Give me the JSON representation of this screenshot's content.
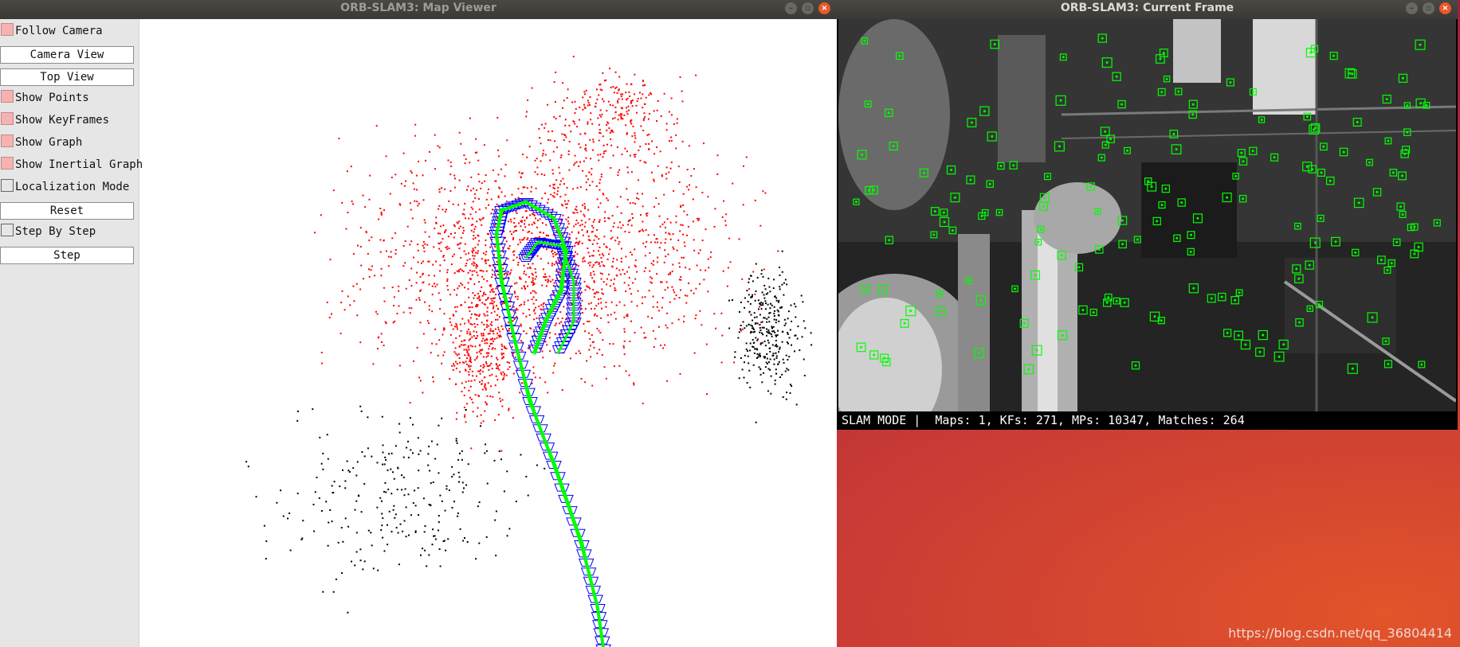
{
  "map_viewer": {
    "title": "ORB-SLAM3: Map Viewer",
    "controls": [
      {
        "type": "checkbox",
        "label": "Follow Camera",
        "checked": true
      },
      {
        "type": "button",
        "label": "Camera View"
      },
      {
        "type": "button",
        "label": "Top View"
      },
      {
        "type": "checkbox",
        "label": "Show Points",
        "checked": true
      },
      {
        "type": "checkbox",
        "label": "Show KeyFrames",
        "checked": true
      },
      {
        "type": "checkbox",
        "label": "Show Graph",
        "checked": true
      },
      {
        "type": "checkbox",
        "label": "Show Inertial Graph",
        "checked": true
      },
      {
        "type": "checkbox",
        "label": "Localization Mode",
        "checked": false
      },
      {
        "type": "button",
        "label": "Reset"
      },
      {
        "type": "checkbox",
        "label": "Step By Step",
        "checked": false
      },
      {
        "type": "button",
        "label": "Step"
      }
    ],
    "colors": {
      "map_points": "#ff0000",
      "reference_points": "#000000",
      "keyframes": "#0000ff",
      "graph": "#00ff00"
    }
  },
  "current_frame": {
    "title": "ORB-SLAM3: Current Frame",
    "status": "SLAM MODE |  Maps: 1, KFs: 271, MPs: 10347, Matches: 264",
    "feature_color": "#00ff00"
  },
  "watermark": "https://blog.csdn.net/qq_36804414",
  "window_buttons": {
    "minimize": "–",
    "maximize": "▫",
    "close": "×"
  }
}
